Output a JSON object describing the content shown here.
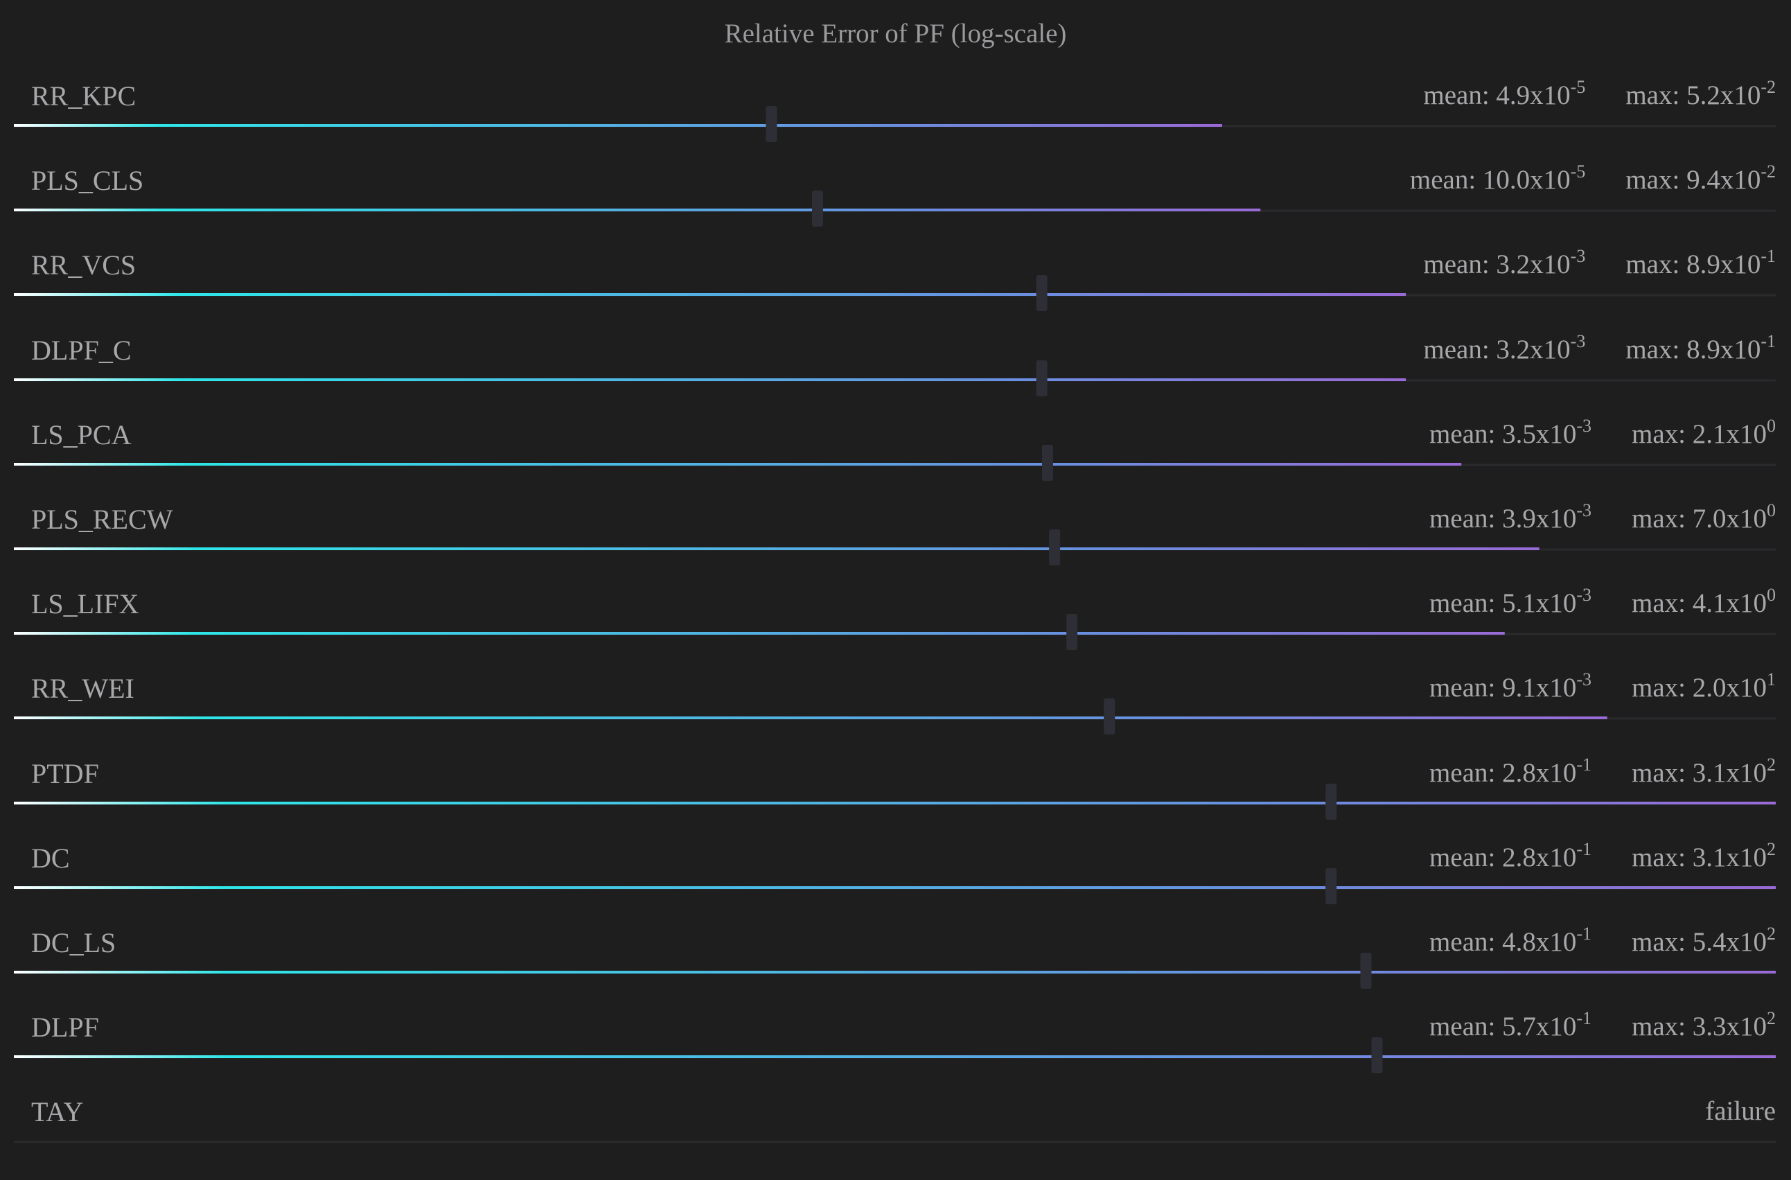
{
  "colors": {
    "background": "#1e1e1f",
    "text": "#a8a8aa",
    "gradient": [
      "#ffffff",
      "#2ee6e8",
      "#6a8fe0",
      "#9a6ad6"
    ],
    "mean_marker": "#2e2e36",
    "track": "#2a2a2c"
  },
  "chart_data": {
    "type": "bar",
    "title": "Relative Error of PF (log-scale)",
    "scale": "log",
    "stat_labels": {
      "mean": "mean: ",
      "max": "max: ",
      "times": "x10"
    },
    "series": [
      {
        "name": "RR_KPC",
        "mean": {
          "m": "4.9",
          "e": "-5"
        },
        "max": {
          "m": "5.2",
          "e": "-2"
        }
      },
      {
        "name": "PLS_CLS",
        "mean": {
          "m": "10.0",
          "e": "-5"
        },
        "max": {
          "m": "9.4",
          "e": "-2"
        }
      },
      {
        "name": "RR_VCS",
        "mean": {
          "m": "3.2",
          "e": "-3"
        },
        "max": {
          "m": "8.9",
          "e": "-1"
        }
      },
      {
        "name": "DLPF_C",
        "mean": {
          "m": "3.2",
          "e": "-3"
        },
        "max": {
          "m": "8.9",
          "e": "-1"
        }
      },
      {
        "name": "LS_PCA",
        "mean": {
          "m": "3.5",
          "e": "-3"
        },
        "max": {
          "m": "2.1",
          "e": "0"
        }
      },
      {
        "name": "PLS_RECW",
        "mean": {
          "m": "3.9",
          "e": "-3"
        },
        "max": {
          "m": "7.0",
          "e": "0"
        }
      },
      {
        "name": "LS_LIFX",
        "mean": {
          "m": "5.1",
          "e": "-3"
        },
        "max": {
          "m": "4.1",
          "e": "0"
        }
      },
      {
        "name": "RR_WEI",
        "mean": {
          "m": "9.1",
          "e": "-3"
        },
        "max": {
          "m": "2.0",
          "e": "1"
        }
      },
      {
        "name": "PTDF",
        "mean": {
          "m": "2.8",
          "e": "-1"
        },
        "max": {
          "m": "3.1",
          "e": "2"
        }
      },
      {
        "name": "DC",
        "mean": {
          "m": "2.8",
          "e": "-1"
        },
        "max": {
          "m": "3.1",
          "e": "2"
        }
      },
      {
        "name": "DC_LS",
        "mean": {
          "m": "4.8",
          "e": "-1"
        },
        "max": {
          "m": "5.4",
          "e": "2"
        }
      },
      {
        "name": "DLPF",
        "mean": {
          "m": "5.7",
          "e": "-1"
        },
        "max": {
          "m": "3.3",
          "e": "2"
        }
      },
      {
        "name": "TAY",
        "status": "failure"
      }
    ]
  }
}
